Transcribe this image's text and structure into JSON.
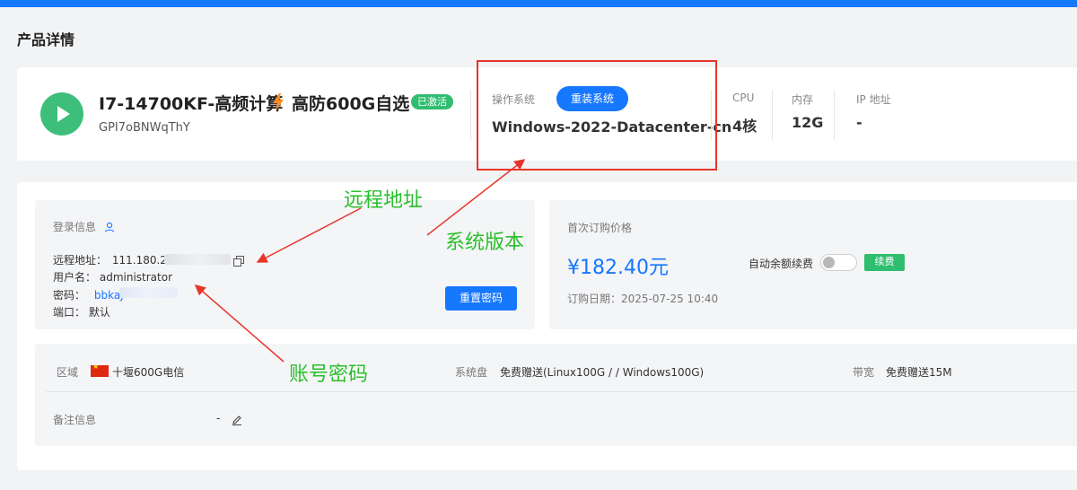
{
  "page": {
    "title": "产品详情"
  },
  "product": {
    "name": "I7-14700KF-高频计算",
    "name_suffix": "高防600G自选",
    "status": "已激活",
    "id": "GPI7oBNWqThY"
  },
  "os": {
    "label": "操作系统",
    "reinstall_label": "重装系统",
    "value": "Windows-2022-Datacenter-cn"
  },
  "specs": {
    "cpu_label": "CPU",
    "cpu_value": "4核",
    "mem_label": "内存",
    "mem_value": "12G",
    "ip_label": "IP 地址",
    "ip_value": "-"
  },
  "login": {
    "title": "登录信息",
    "remote_label": "远程地址：",
    "remote_value": "111.180.2",
    "user_label": "用户名：",
    "user_value": "administrator",
    "password_label": "密码：",
    "password_value": "bbkaJ",
    "port_label": "端口：",
    "port_value": "默认",
    "reset_label": "重置密码"
  },
  "price": {
    "title": "首次订购价格",
    "value": "¥182.40元",
    "autorenew_label": "自动余额续费",
    "autorenew_on": false,
    "renew_label": "续费",
    "order_date": "订购日期：2025-07-25 10:40"
  },
  "info": {
    "region_label": "区域",
    "region_value": "十堰600G电信",
    "disk_label": "系统盘",
    "disk_value": "免费赠送(Linux100G / / Windows100G)",
    "bandwidth_label": "带宽",
    "bandwidth_value": "免费赠送15M",
    "remark_label": "备注信息",
    "remark_value": "-"
  },
  "annotations": {
    "remote": "远程地址",
    "os_version": "系统版本",
    "account": "账号密码"
  },
  "colors": {
    "primary": "#1677ff",
    "success": "#2fbd6f",
    "annotation_text": "#2bbf2b",
    "annotation_line": "#e8352a"
  }
}
